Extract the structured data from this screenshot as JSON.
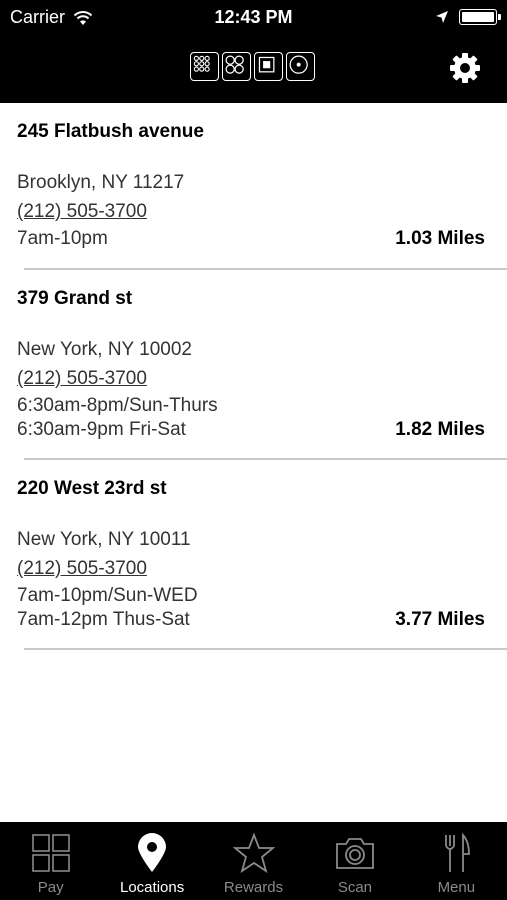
{
  "status_bar": {
    "carrier": "Carrier",
    "time": "12:43 PM",
    "battery_level": 1.0
  },
  "nav": {
    "settings_icon": "gear-icon"
  },
  "locations": [
    {
      "name": "245 Flatbush avenue",
      "city": "Brooklyn, NY 11217",
      "phone": "(212) 505-3700",
      "hours": [
        "7am-10pm"
      ],
      "distance": "1.03 Miles"
    },
    {
      "name": "379 Grand st",
      "city": "New York, NY 10002",
      "phone": "(212) 505-3700",
      "hours": [
        "6:30am-8pm/Sun-Thurs",
        "6:30am-9pm Fri-Sat"
      ],
      "distance": "1.82 Miles"
    },
    {
      "name": "220 West 23rd st",
      "city": "New York, NY 10011",
      "phone": "(212) 505-3700",
      "hours": [
        "7am-10pm/Sun-WED",
        "7am-12pm Thus-Sat"
      ],
      "distance": "3.77 Miles"
    }
  ],
  "tabs": [
    {
      "label": "Pay",
      "icon": "grid-icon",
      "active": false
    },
    {
      "label": "Locations",
      "icon": "map-pin-icon",
      "active": true
    },
    {
      "label": "Rewards",
      "icon": "star-icon",
      "active": false
    },
    {
      "label": "Scan",
      "icon": "camera-icon",
      "active": false
    },
    {
      "label": "Menu",
      "icon": "fork-knife-icon",
      "active": false
    }
  ],
  "colors": {
    "bar_background": "#000000",
    "tab_active": "#ffffff",
    "tab_inactive": "#8a8a8a",
    "divider": "#c8c8c8"
  }
}
